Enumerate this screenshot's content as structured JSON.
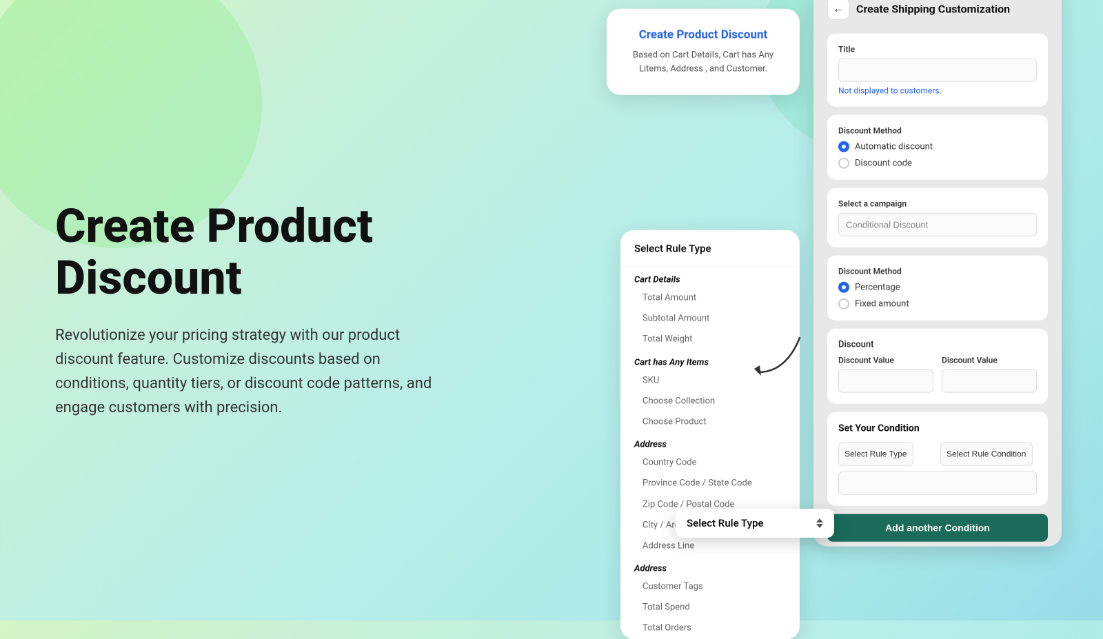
{
  "background": {
    "gradient": "linear-gradient(135deg, #d4f5c4 0%, #c8f0d8 20%, #b8eee8 50%, #a8e8e8 80%, #98dce8 100%)"
  },
  "hero": {
    "title": "Create Product Discount",
    "description": "Revolutionize your pricing strategy with our product discount feature. Customize discounts based on conditions, quantity tiers, or discount code patterns, and engage customers with precision."
  },
  "product_card": {
    "title": "Create Product Discount",
    "description": "Based on Cart Details, Cart has Any Litems, Address , and Customer."
  },
  "rule_type_card": {
    "header": "Select Rule Type",
    "sections": [
      {
        "title": "Cart Details",
        "items": [
          "Total Amount",
          "Subtotal Amount",
          "Total Weight"
        ]
      },
      {
        "title": "Cart has Any Items",
        "items": [
          "SKU",
          "Choose Collection",
          "Choose Product"
        ]
      },
      {
        "title": "Address",
        "items": [
          "Country Code",
          "Province Code / State Code",
          "Zip Code / Postal Code",
          "City / Area",
          "Address Line"
        ]
      },
      {
        "title": "Address",
        "items": [
          "Customer Tags",
          "Total Spend",
          "Total Orders"
        ]
      }
    ]
  },
  "select_rule_dropdown": {
    "label": "Select Rule Type"
  },
  "shipping_panel": {
    "title": "Create Shipping Customization",
    "back_button": "←",
    "title_section": {
      "label": "Title",
      "placeholder": "",
      "note": "Not displayed to customers."
    },
    "discount_method_section": {
      "label": "Discount Method",
      "options": [
        "Automatic discount",
        "Discount code"
      ],
      "selected": "Automatic discount"
    },
    "campaign_section": {
      "label": "Select a campaign",
      "value": "Conditional Discount"
    },
    "discount_method2_section": {
      "label": "Discount Method",
      "options": [
        "Percentage",
        "Fixed amount"
      ],
      "selected": "Percentage"
    },
    "discount_section": {
      "label": "Discount",
      "value_label1": "Discount Value",
      "value_label2": "Discount Value"
    },
    "condition_section": {
      "title": "Set Your Condition",
      "rule_type_placeholder": "Select Rule Type",
      "condition_placeholder": "Select Rule Condition"
    },
    "add_condition_btn": "Add another Condition"
  }
}
